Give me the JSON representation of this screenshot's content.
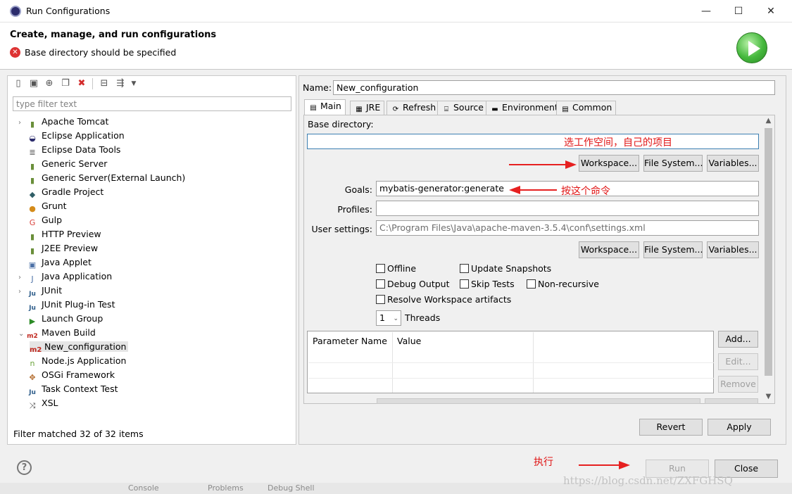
{
  "window": {
    "title": "Run Configurations",
    "minimize_icon": "—",
    "maximize_icon": "☐",
    "close_icon": "✕"
  },
  "header": {
    "title": "Create, manage, and run configurations",
    "error_message": "Base directory should be specified"
  },
  "left": {
    "filter_placeholder": "type filter text",
    "tree": [
      {
        "label": "Apache Tomcat",
        "expander": "›",
        "icon": "▮",
        "color": "#6a8f3a"
      },
      {
        "label": "Eclipse Application",
        "expander": "",
        "icon": "◒",
        "color": "#2c2c6c"
      },
      {
        "label": "Eclipse Data Tools",
        "expander": "",
        "icon": "≣",
        "color": "#555555"
      },
      {
        "label": "Generic Server",
        "expander": "",
        "icon": "▮",
        "color": "#6a8f3a"
      },
      {
        "label": "Generic Server(External Launch)",
        "expander": "",
        "icon": "▮",
        "color": "#6a8f3a"
      },
      {
        "label": "Gradle Project",
        "expander": "",
        "icon": "◆",
        "color": "#2f5e66"
      },
      {
        "label": "Grunt",
        "expander": "",
        "icon": "●",
        "color": "#d48b1a"
      },
      {
        "label": "Gulp",
        "expander": "",
        "icon": "G",
        "color": "#d9403a"
      },
      {
        "label": "HTTP Preview",
        "expander": "",
        "icon": "▮",
        "color": "#6a8f3a"
      },
      {
        "label": "J2EE Preview",
        "expander": "",
        "icon": "▮",
        "color": "#6a8f3a"
      },
      {
        "label": "Java Applet",
        "expander": "",
        "icon": "▣",
        "color": "#4a6fa5"
      },
      {
        "label": "Java Application",
        "expander": "›",
        "icon": "J",
        "color": "#4a6fa5"
      },
      {
        "label": "JUnit",
        "expander": "›",
        "icon": "Ju",
        "color": "#2e5d8a"
      },
      {
        "label": "JUnit Plug-in Test",
        "expander": "",
        "icon": "Ju",
        "color": "#2e5d8a"
      },
      {
        "label": "Launch Group",
        "expander": "",
        "icon": "▶",
        "color": "#2c8b26"
      },
      {
        "label": "Maven Build",
        "expander": "⌄",
        "icon": "m2",
        "color": "#c0281f"
      },
      {
        "label": "Node.js Application",
        "expander": "",
        "icon": "n",
        "color": "#6aa33a"
      },
      {
        "label": "OSGi Framework",
        "expander": "",
        "icon": "✥",
        "color": "#b36b2c"
      },
      {
        "label": "Task Context Test",
        "expander": "",
        "icon": "Ju",
        "color": "#2e5d8a"
      },
      {
        "label": "XSL",
        "expander": "",
        "icon": "⤨",
        "color": "#444444"
      }
    ],
    "child": {
      "label": "New_configuration",
      "icon": "m2"
    },
    "filter_status": "Filter matched 32 of 32 items"
  },
  "right": {
    "name_label": "Name:",
    "name_value": "New_configuration",
    "tabs": [
      {
        "label": "Main",
        "icon": "▤"
      },
      {
        "label": "JRE",
        "icon": "▦"
      },
      {
        "label": "Refresh",
        "icon": "⟳"
      },
      {
        "label": "Source",
        "icon": "⌸"
      },
      {
        "label": "Environment",
        "icon": "▬"
      },
      {
        "label": "Common",
        "icon": "▤"
      }
    ],
    "base_directory_label": "Base directory:",
    "base_directory_value": "",
    "workspace_btn": "Workspace...",
    "filesystem_btn": "File System...",
    "variables_btn": "Variables...",
    "goals_label": "Goals:",
    "goals_value": "mybatis-generator:generate",
    "profiles_label": "Profiles:",
    "profiles_value": "",
    "user_settings_label": "User settings:",
    "user_settings_value": "C:\\Program Files\\Java\\apache-maven-3.5.4\\conf\\settings.xml",
    "checkboxes": {
      "offline": "Offline",
      "update_snapshots": "Update Snapshots",
      "debug_output": "Debug Output",
      "skip_tests": "Skip Tests",
      "non_recursive": "Non-recursive",
      "resolve_workspace": "Resolve Workspace artifacts"
    },
    "threads_value": "1",
    "threads_label": "Threads",
    "param_col_name": "Parameter Name",
    "param_col_value": "Value",
    "add_btn": "Add...",
    "edit_btn": "Edit...",
    "remove_btn": "Remove",
    "revert_btn": "Revert",
    "apply_btn": "Apply"
  },
  "annotations": {
    "base_dir_note": "选工作空间，自己的项目",
    "goals_note": "按这个命令",
    "run_note": "执行"
  },
  "footer": {
    "help_icon": "?",
    "run_btn": "Run",
    "close_btn": "Close"
  },
  "watermark": "https://blog.csdn.net/ZXFGHSQ",
  "background_strip": {
    "console": "Console",
    "problems": "Problems",
    "debug_shell": "Debug Shell"
  }
}
